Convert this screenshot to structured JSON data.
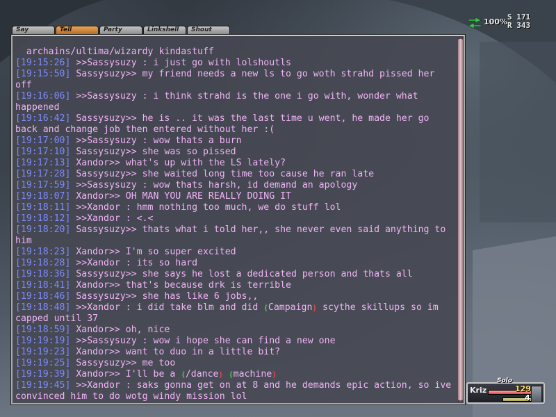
{
  "tabs": [
    {
      "label": "Say",
      "active": false
    },
    {
      "label": "Tell",
      "active": true
    },
    {
      "label": "Party",
      "active": false
    },
    {
      "label": "Linkshell",
      "active": false
    },
    {
      "label": "Shout",
      "active": false
    }
  ],
  "colors": {
    "message": "#f1b4f7",
    "timestamp": "#7e8bff",
    "autotranslate_open": "#4ad24a",
    "autotranslate_close": "#e34545"
  },
  "chat_log": [
    {
      "ts": "",
      "text": "  archains/ultima/wizardy kindastuff"
    },
    {
      "ts": "[19:15:26]",
      "text": " >>Sassysuzy : i just go with lolshoutls"
    },
    {
      "ts": "[19:15:50]",
      "text": " Sassysuzy>> my friend needs a new ls to go woth strahd pissed her off"
    },
    {
      "ts": "[19:16:06]",
      "text": " >>Sassysuzy : i think strahd is the one i go with, wonder what happened"
    },
    {
      "ts": "[19:16:42]",
      "text": " Sassysuzy>> he is .. it was the last time u went, he made her go back and change job then entered without her :("
    },
    {
      "ts": "[19:17:00]",
      "text": " >>Sassysuzy : wow thats a burn"
    },
    {
      "ts": "[19:17:10]",
      "text": " Sassysuzy>> she was so pissed"
    },
    {
      "ts": "[19:17:13]",
      "text": " Xandor>> what's up with the LS lately?"
    },
    {
      "ts": "[19:17:28]",
      "text": " Sassysuzy>> she waited long time too cause he ran late"
    },
    {
      "ts": "[19:17:59]",
      "text": " >>Sassysuzy : wow thats harsh, id demand an apology"
    },
    {
      "ts": "[19:18:07]",
      "text": " Xandor>> OH MAN YOU ARE REALLY DOING IT"
    },
    {
      "ts": "[19:18:11]",
      "text": " >>Xandor : hmm nothing too much, we do stuff lol"
    },
    {
      "ts": "[19:18:12]",
      "text": " >>Xandor : <.<"
    },
    {
      "ts": "[19:18:20]",
      "text": " Sassysuzy>> thats what i told her,, she never even said anything to him"
    },
    {
      "ts": "[19:18:23]",
      "text": " Xandor>> I'm so super excited"
    },
    {
      "ts": "[19:18:28]",
      "text": " >>Xandor : its so hard"
    },
    {
      "ts": "[19:18:36]",
      "text": " Sassysuzy>> she says he lost a dedicated person and thats all"
    },
    {
      "ts": "[19:18:41]",
      "text": " Xandor>> that's because drk is terrible"
    },
    {
      "ts": "[19:18:46]",
      "text": " Sassysuzy>> she has like 6 jobs,,"
    },
    {
      "ts": "[19:18:48]",
      "text": " >>Xandor : i did take blm and did ",
      "at": "Campaign",
      "after": " scythe skillups so im capped until 37"
    },
    {
      "ts": "[19:18:59]",
      "text": " Xandor>> oh, nice"
    },
    {
      "ts": "[19:19:19]",
      "text": " >>Sassysuzy : wow i hope she can find a new one"
    },
    {
      "ts": "[19:19:23]",
      "text": " Xandor>> want to duo in a little bit?"
    },
    {
      "ts": "[19:19:25]",
      "text": " Sassysuzy>> me too"
    },
    {
      "ts": "[19:19:39]",
      "text": " Xandor>> I'll be a ",
      "at": "/dance",
      "after": " ",
      "at2": "machine"
    },
    {
      "ts": "[19:19:45]",
      "text": " >>Xandor : saks gonna get on at 8 and he demands epic action, so ive convinced him to do wotg windy mission lol"
    }
  ],
  "compass": {
    "percent": "100%",
    "s": "S 171",
    "r": "R 343"
  },
  "party": {
    "mode": "Solo",
    "name": "Kriz",
    "hp": "129",
    "mp": "42",
    "hp_fraction": 1.0,
    "mp_fraction": 1.0
  }
}
